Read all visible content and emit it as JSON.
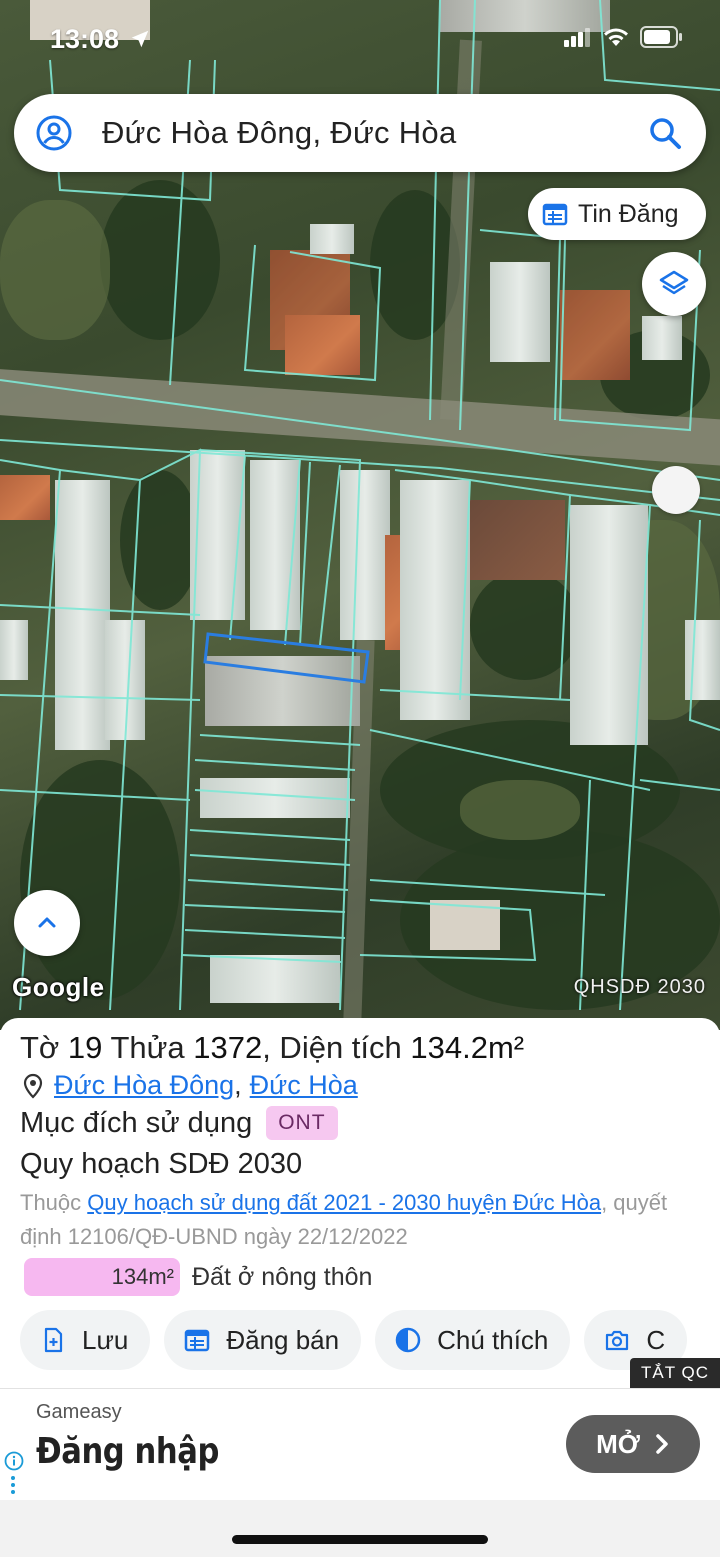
{
  "status_bar": {
    "time": "13:08"
  },
  "search": {
    "text": "Đức Hòa Đông, Đức Hòa"
  },
  "map": {
    "tin_dang_label": "Tin Đăng",
    "google_logo": "Google",
    "plan_label": "QHSDĐ 2030"
  },
  "parcel": {
    "to_label": "Tờ",
    "to_value": "19",
    "thua_label": "Thửa",
    "thua_value": "1372",
    "area_label": ", Diện tích",
    "area_value": "134.2m²",
    "location_commune": "Đức Hòa Đông",
    "location_sep": ",",
    "location_district": "Đức Hòa",
    "purpose_label": "Mục đích sử dụng",
    "purpose_code": "ONT",
    "plan_title": "Quy hoạch SDĐ 2030",
    "belong_prefix": "Thuộc",
    "belong_link": "Quy hoạch sử dụng đất 2021 - 2030 huyện Đức Hòa",
    "belong_suffix": ", quyết định 12106/QĐ-UBND ngày 22/12/2022",
    "legend_area": "134m²",
    "legend_text": "Đất ở nông thôn"
  },
  "actions": [
    {
      "label": "Lưu",
      "icon": "save-doc-icon"
    },
    {
      "label": "Đăng bán",
      "icon": "calendar-icon"
    },
    {
      "label": "Chú thích",
      "icon": "contrast-icon"
    },
    {
      "label": "C",
      "icon": "camera-icon"
    }
  ],
  "ad": {
    "close_label": "TẮT QC",
    "brand": "Gameasy",
    "headline": "Đăng nhập",
    "cta": "MỞ"
  },
  "colors": {
    "accent": "#1a73e8",
    "badge_bg": "#f6c8f0",
    "parcel_line": "#7fe8d6",
    "selected_parcel": "#2a7de1"
  }
}
